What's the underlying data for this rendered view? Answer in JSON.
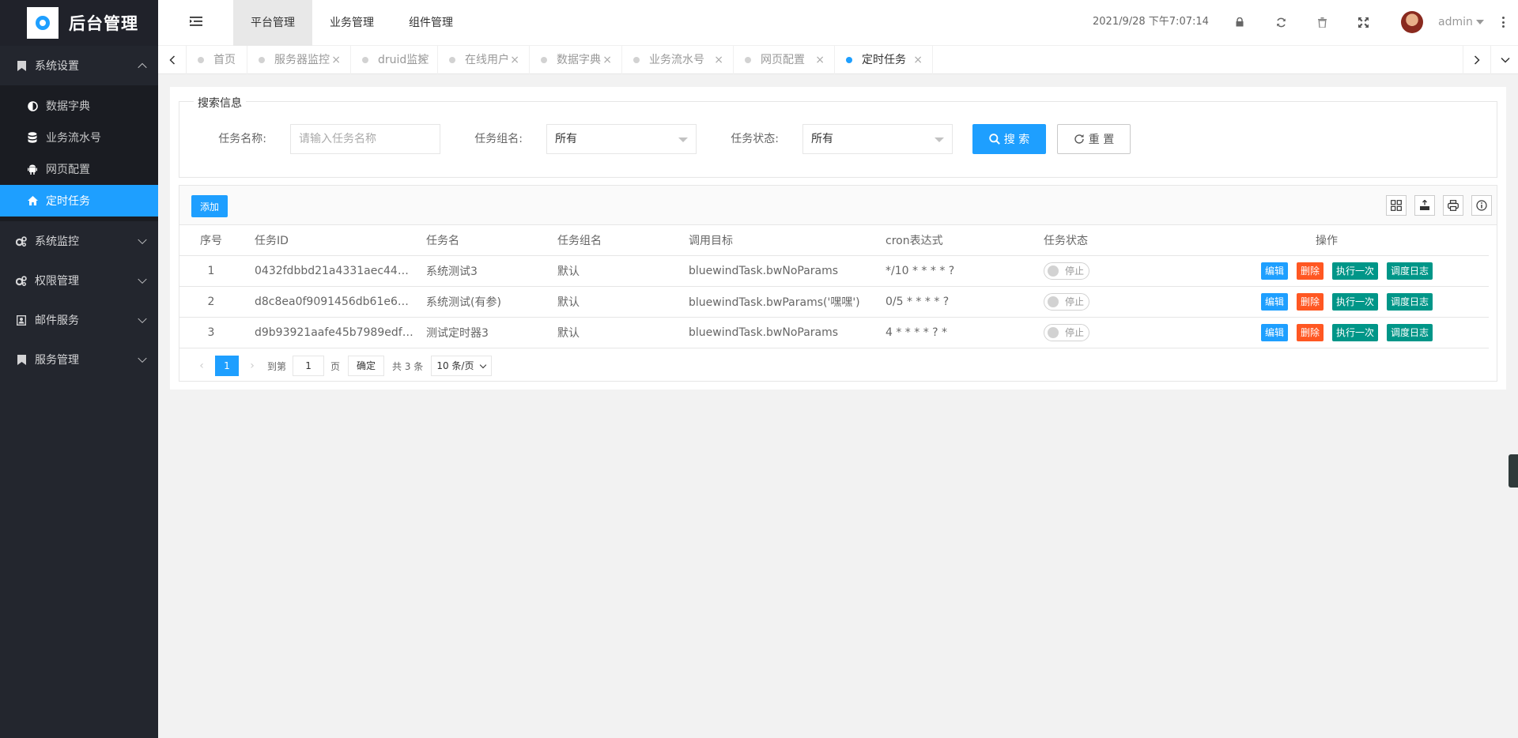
{
  "app": {
    "title": "后台管理"
  },
  "sidebar": {
    "groups": [
      {
        "label": "系统设置",
        "icon": "bookmark-icon"
      },
      {
        "label": "系统监控",
        "icon": "gears-icon"
      },
      {
        "label": "权限管理",
        "icon": "gears-icon"
      },
      {
        "label": "邮件服务",
        "icon": "mail-icon"
      },
      {
        "label": "服务管理",
        "icon": "bookmark-icon"
      }
    ],
    "sub_items": [
      {
        "label": "数据字典",
        "icon": "adjust-icon"
      },
      {
        "label": "业务流水号",
        "icon": "database-icon"
      },
      {
        "label": "网页配置",
        "icon": "android-icon"
      },
      {
        "label": "定时任务",
        "icon": "home-icon"
      }
    ]
  },
  "header": {
    "top_tabs": [
      "平台管理",
      "业务管理",
      "组件管理"
    ],
    "datetime": "2021/9/28 下午7:07:14",
    "user": "admin"
  },
  "tabs": [
    "首页",
    "服务器监控",
    "druid监控",
    "在线用户",
    "数据字典",
    "业务流水号",
    "网页配置",
    "定时任务"
  ],
  "search": {
    "legend": "搜索信息",
    "task_name_label": "任务名称:",
    "task_name_placeholder": "请输入任务名称",
    "task_group_label": "任务组名:",
    "task_group_value": "所有",
    "task_status_label": "任务状态:",
    "task_status_value": "所有",
    "search_btn": "搜 索",
    "reset_btn": "重 置"
  },
  "table": {
    "add_btn": "添加",
    "columns": [
      "序号",
      "任务ID",
      "任务名",
      "任务组名",
      "调用目标",
      "cron表达式",
      "任务状态",
      "操作"
    ],
    "rows": [
      [
        "1",
        "0432fdbbd21a4331aec44d...",
        "系统测试3",
        "默认",
        "bluewindTask.bwNoParams",
        "*/10 * * * * ?",
        "停止"
      ],
      [
        "2",
        "d8c8ea0f9091456db61e6e...",
        "系统测试(有参)",
        "默认",
        "bluewindTask.bwParams('嘿嘿')",
        "0/5 * * * * ?",
        "停止"
      ],
      [
        "3",
        "d9b93921aafe45b7989edf3...",
        "测试定时器3",
        "默认",
        "bluewindTask.bwNoParams",
        "4 * * * * ? *",
        "停止"
      ]
    ],
    "ops": {
      "edit": "编辑",
      "delete": "删除",
      "run_once": "执行一次",
      "log": "调度日志"
    }
  },
  "pager": {
    "current": "1",
    "goto_label": "到第",
    "goto_value": "1",
    "page_unit": "页",
    "confirm": "确定",
    "total": "共 3 条",
    "page_size": "10 条/页"
  }
}
